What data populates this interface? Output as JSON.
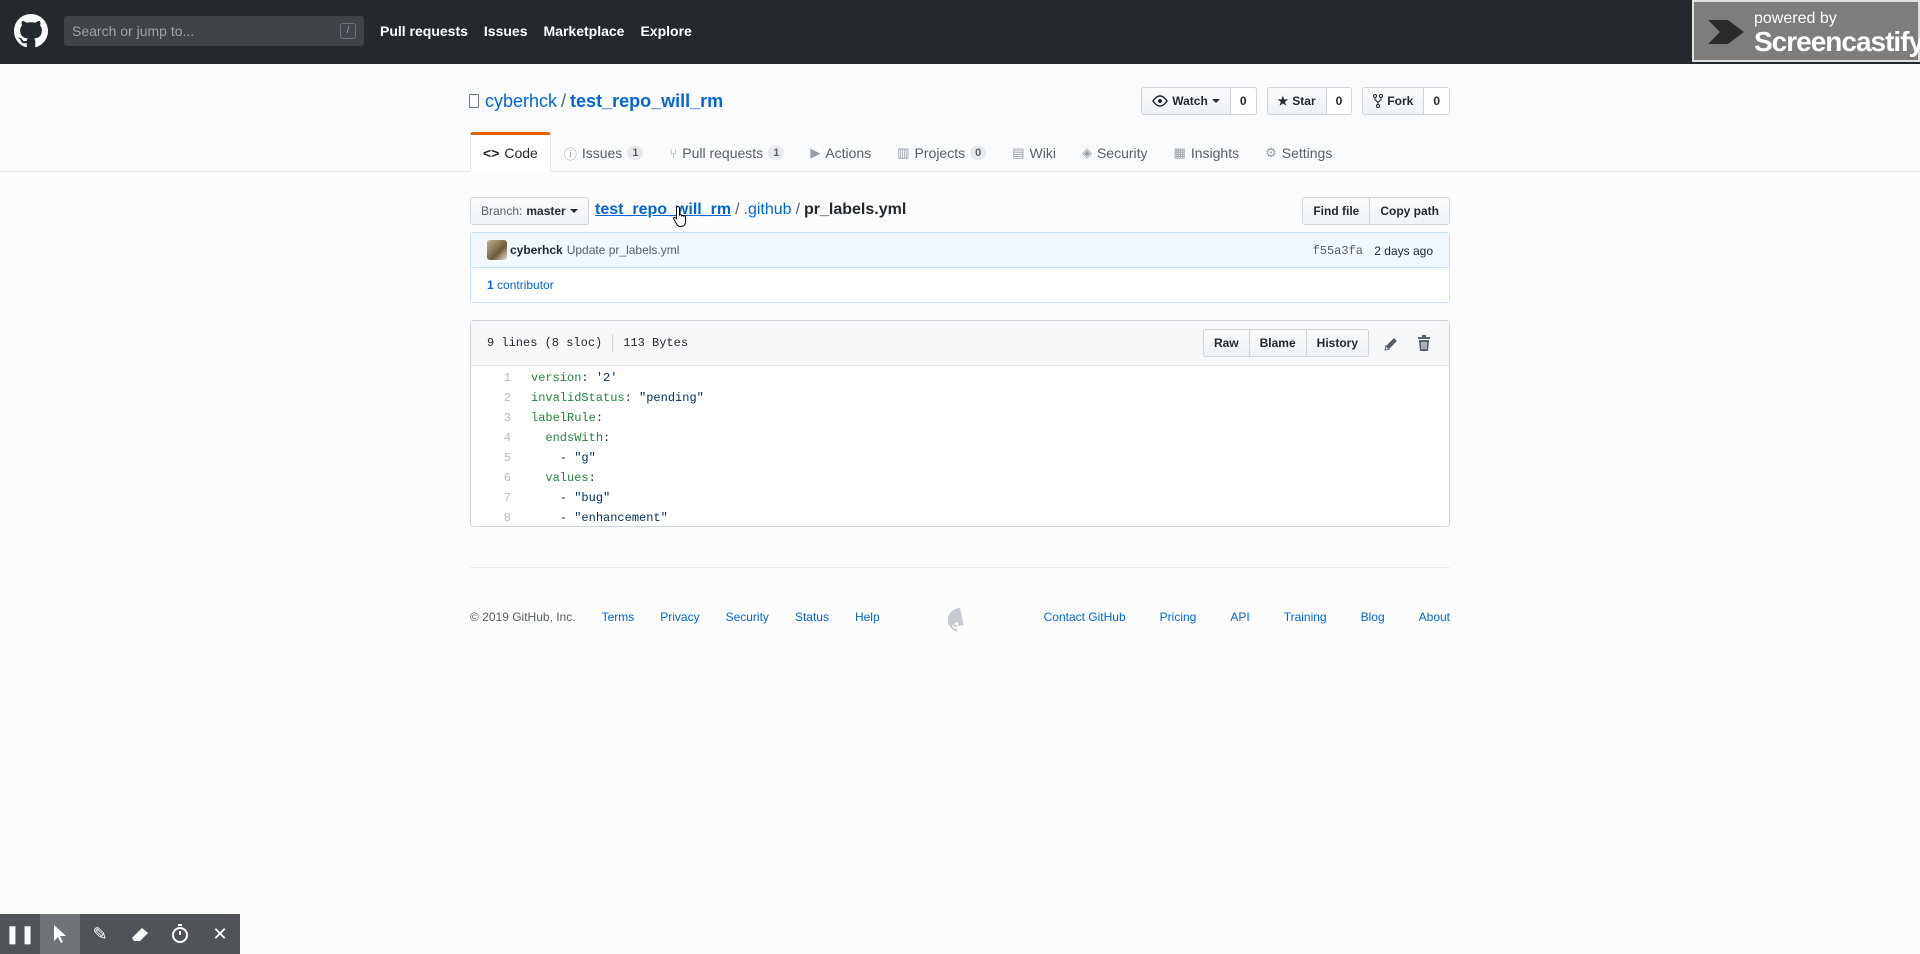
{
  "header": {
    "search_placeholder": "Search or jump to...",
    "search_shortcut": "/",
    "nav": [
      "Pull requests",
      "Issues",
      "Marketplace",
      "Explore"
    ]
  },
  "screencastify_badge": {
    "line1": "powered by",
    "line2": "Screencastify"
  },
  "repo": {
    "owner": "cyberhck",
    "separator": "/",
    "name": "test_repo_will_rm",
    "actions": {
      "watch": {
        "label": "Watch",
        "count": "0"
      },
      "star": {
        "label": "Star",
        "count": "0"
      },
      "fork": {
        "label": "Fork",
        "count": "0"
      }
    },
    "tabs": [
      {
        "label": "Code",
        "icon": "code-icon",
        "counter": ""
      },
      {
        "label": "Issues",
        "icon": "issue-icon",
        "counter": "1"
      },
      {
        "label": "Pull requests",
        "icon": "pr-icon",
        "counter": "1"
      },
      {
        "label": "Actions",
        "icon": "play-icon",
        "counter": ""
      },
      {
        "label": "Projects",
        "icon": "project-icon",
        "counter": "0"
      },
      {
        "label": "Wiki",
        "icon": "book-icon",
        "counter": ""
      },
      {
        "label": "Security",
        "icon": "shield-icon",
        "counter": ""
      },
      {
        "label": "Insights",
        "icon": "graph-icon",
        "counter": ""
      },
      {
        "label": "Settings",
        "icon": "gear-icon",
        "counter": ""
      }
    ]
  },
  "file_nav": {
    "branch_prefix": "Branch:",
    "branch": "master",
    "crumbs": [
      "test_repo_will_rm",
      ".github"
    ],
    "separator": "/",
    "file": "pr_labels.yml",
    "find_file": "Find file",
    "copy_path": "Copy path"
  },
  "commit": {
    "author": "cyberhck",
    "message": "Update pr_labels.yml",
    "sha": "f55a3fa",
    "date": "2 days ago",
    "contributors_count": "1",
    "contributors_label": "contributor"
  },
  "file": {
    "lines_info": "9 lines (8 sloc)",
    "size": "113 Bytes",
    "buttons": [
      "Raw",
      "Blame",
      "History"
    ],
    "code_lines": [
      {
        "n": "1",
        "indent": "",
        "key": "version",
        "sep": ": ",
        "val": "'2'"
      },
      {
        "n": "2",
        "indent": "",
        "key": "invalidStatus",
        "sep": ": ",
        "val": "\"pending\""
      },
      {
        "n": "3",
        "indent": "",
        "key": "labelRule",
        "sep": ":",
        "val": ""
      },
      {
        "n": "4",
        "indent": "  ",
        "key": "endsWith",
        "sep": ":",
        "val": ""
      },
      {
        "n": "5",
        "indent": "    ",
        "key": "",
        "sep": "- ",
        "val": "\"g\""
      },
      {
        "n": "6",
        "indent": "  ",
        "key": "values",
        "sep": ":",
        "val": ""
      },
      {
        "n": "7",
        "indent": "    ",
        "key": "",
        "sep": "- ",
        "val": "\"bug\""
      },
      {
        "n": "8",
        "indent": "    ",
        "key": "",
        "sep": "- ",
        "val": "\"enhancement\""
      }
    ]
  },
  "footer": {
    "copyright": "© 2019 GitHub, Inc.",
    "left_links": [
      "Terms",
      "Privacy",
      "Security",
      "Status",
      "Help"
    ],
    "right_links": [
      "Contact GitHub",
      "Pricing",
      "API",
      "Training",
      "Blog",
      "About"
    ]
  },
  "recorder_toolbar": [
    "pause-icon",
    "cursor-icon",
    "pen-icon",
    "eraser-icon",
    "timer-icon",
    "close-icon"
  ],
  "colors": {
    "header_bg": "#24292e",
    "link": "#0366d6",
    "tab_accent": "#e36209"
  }
}
